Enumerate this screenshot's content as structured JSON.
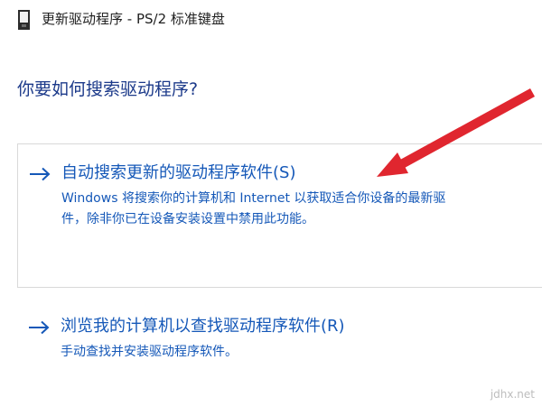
{
  "window": {
    "title": "更新驱动程序 - PS/2 标准键盘",
    "icon": "keyboard-device-icon"
  },
  "question": "你要如何搜索驱动程序?",
  "options": [
    {
      "arrow_icon": "right-arrow-icon",
      "title": "自动搜索更新的驱动程序软件(S)",
      "desc_line1": "Windows 将搜索你的计算机和 Internet 以获取适合你设备的最新驱",
      "desc_line2": "件，除非你已在设备安装设置中禁用此功能。"
    },
    {
      "arrow_icon": "right-arrow-icon",
      "title": "浏览我的计算机以查找驱动程序软件(R)",
      "desc_line1": "手动查找并安装驱动程序软件。"
    }
  ],
  "annotation": {
    "icon": "red-pointer-arrow",
    "color": "#e0262f"
  },
  "watermark": "jdhx.net",
  "colors": {
    "link": "#1558b8",
    "heading": "#1c3a8a",
    "border": "#d9d9d9"
  }
}
